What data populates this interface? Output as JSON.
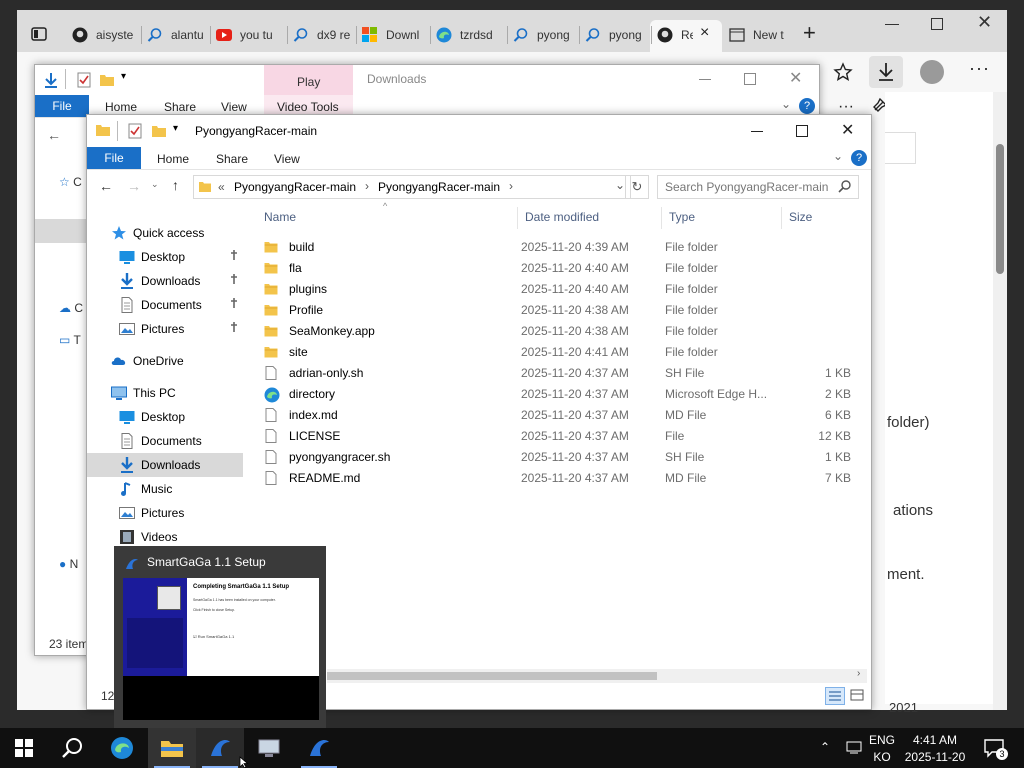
{
  "browser": {
    "tabs": [
      {
        "label": "aisyste",
        "icon": "github-icon"
      },
      {
        "label": "alantu",
        "icon": "search-icon"
      },
      {
        "label": "you tu",
        "icon": "youtube-icon"
      },
      {
        "label": "dx9 re",
        "icon": "search-icon"
      },
      {
        "label": "Downl",
        "icon": "microsoft-icon"
      },
      {
        "label": "tzrdsd",
        "icon": "edge-icon"
      },
      {
        "label": "pyong",
        "icon": "search-icon"
      },
      {
        "label": "pyong",
        "icon": "search-icon"
      },
      {
        "label": "Re",
        "icon": "github-icon",
        "active": true
      },
      {
        "label": "New t",
        "icon": "newtab-icon"
      }
    ],
    "close_tab": "×",
    "new_tab": "+",
    "page_fragments": {
      "folder_text": "folder)",
      "ations_text": "ations",
      "ment_text": "ment.",
      "year_text": "2021"
    }
  },
  "downloads_window": {
    "title": "Downloads",
    "play_tab": "Play",
    "ribbon": {
      "file": "File",
      "home": "Home",
      "share": "Share",
      "view": "View",
      "video_tools": "Video Tools"
    },
    "status": "23 item",
    "nav_partial": {
      "c1": "C",
      "c2": "C",
      "t": "T",
      "n": "N"
    }
  },
  "explorer": {
    "title": "PyongyangRacer-main",
    "ribbon": {
      "file": "File",
      "home": "Home",
      "share": "Share",
      "view": "View"
    },
    "address": {
      "root": "«",
      "crumbs": [
        "PyongyangRacer-main",
        "PyongyangRacer-main"
      ]
    },
    "search_placeholder": "Search PyongyangRacer-main",
    "columns": {
      "name": "Name",
      "date": "Date modified",
      "type": "Type",
      "size": "Size"
    },
    "nav": [
      {
        "label": "Quick access",
        "icon": "star-icon",
        "indent": 0
      },
      {
        "label": "Desktop",
        "icon": "desktop-icon",
        "indent": 1,
        "pinned": true
      },
      {
        "label": "Downloads",
        "icon": "download-icon",
        "indent": 1,
        "pinned": true
      },
      {
        "label": "Documents",
        "icon": "document-icon",
        "indent": 1,
        "pinned": true
      },
      {
        "label": "Pictures",
        "icon": "pictures-icon",
        "indent": 1,
        "pinned": true
      },
      {
        "label": "OneDrive",
        "icon": "cloud-icon",
        "indent": 0
      },
      {
        "label": "This PC",
        "icon": "pc-icon",
        "indent": 0
      },
      {
        "label": "Desktop",
        "icon": "desktop-icon",
        "indent": 1
      },
      {
        "label": "Documents",
        "icon": "document-icon",
        "indent": 1
      },
      {
        "label": "Downloads",
        "icon": "download-icon",
        "indent": 1,
        "selected": true
      },
      {
        "label": "Music",
        "icon": "music-icon",
        "indent": 1
      },
      {
        "label": "Pictures",
        "icon": "pictures-icon",
        "indent": 1
      },
      {
        "label": "Videos",
        "icon": "videos-icon",
        "indent": 1
      }
    ],
    "files": [
      {
        "name": "build",
        "date": "2025-11-20 4:39 AM",
        "type": "File folder",
        "size": "",
        "icon": "folder-icon"
      },
      {
        "name": "fla",
        "date": "2025-11-20 4:40 AM",
        "type": "File folder",
        "size": "",
        "icon": "folder-icon"
      },
      {
        "name": "plugins",
        "date": "2025-11-20 4:40 AM",
        "type": "File folder",
        "size": "",
        "icon": "folder-icon"
      },
      {
        "name": "Profile",
        "date": "2025-11-20 4:38 AM",
        "type": "File folder",
        "size": "",
        "icon": "folder-icon"
      },
      {
        "name": "SeaMonkey.app",
        "date": "2025-11-20 4:38 AM",
        "type": "File folder",
        "size": "",
        "icon": "folder-icon"
      },
      {
        "name": "site",
        "date": "2025-11-20 4:41 AM",
        "type": "File folder",
        "size": "",
        "icon": "folder-icon"
      },
      {
        "name": "adrian-only.sh",
        "date": "2025-11-20 4:37 AM",
        "type": "SH File",
        "size": "1 KB",
        "icon": "file-icon"
      },
      {
        "name": "directory",
        "date": "2025-11-20 4:37 AM",
        "type": "Microsoft Edge H...",
        "size": "2 KB",
        "icon": "edge-icon"
      },
      {
        "name": "index.md",
        "date": "2025-11-20 4:37 AM",
        "type": "MD File",
        "size": "6 KB",
        "icon": "file-icon"
      },
      {
        "name": "LICENSE",
        "date": "2025-11-20 4:37 AM",
        "type": "File",
        "size": "12 KB",
        "icon": "file-icon"
      },
      {
        "name": "pyongyangracer.sh",
        "date": "2025-11-20 4:37 AM",
        "type": "SH File",
        "size": "1 KB",
        "icon": "file-icon"
      },
      {
        "name": "README.md",
        "date": "2025-11-20 4:37 AM",
        "type": "MD File",
        "size": "7 KB",
        "icon": "file-icon"
      }
    ],
    "status_partial": "12"
  },
  "preview": {
    "title": "SmartGaGa 1.1 Setup",
    "heading": "Completing SmartGaGa 1.1 Setup",
    "line1": "SmartGaGa 1.1 has been installed on your computer.",
    "line2": "Click Finish to close Setup.",
    "checkbox": "Run SmartGaGa 1.1"
  },
  "taskbar": {
    "icons": [
      "windows-start-icon",
      "search-icon",
      "edge-icon",
      "file-explorer-icon",
      "smartgaga-icon",
      "computer-icon",
      "smartgaga-icon"
    ],
    "lang_top": "ENG",
    "lang_bottom": "KO",
    "time": "4:41 AM",
    "date": "2025-11-20",
    "notifications": "3"
  },
  "colors": {
    "accent": "#1a6fc7",
    "selection": "#d9d9d9",
    "folder": "#f3c44b",
    "taskbar": "#101010"
  }
}
